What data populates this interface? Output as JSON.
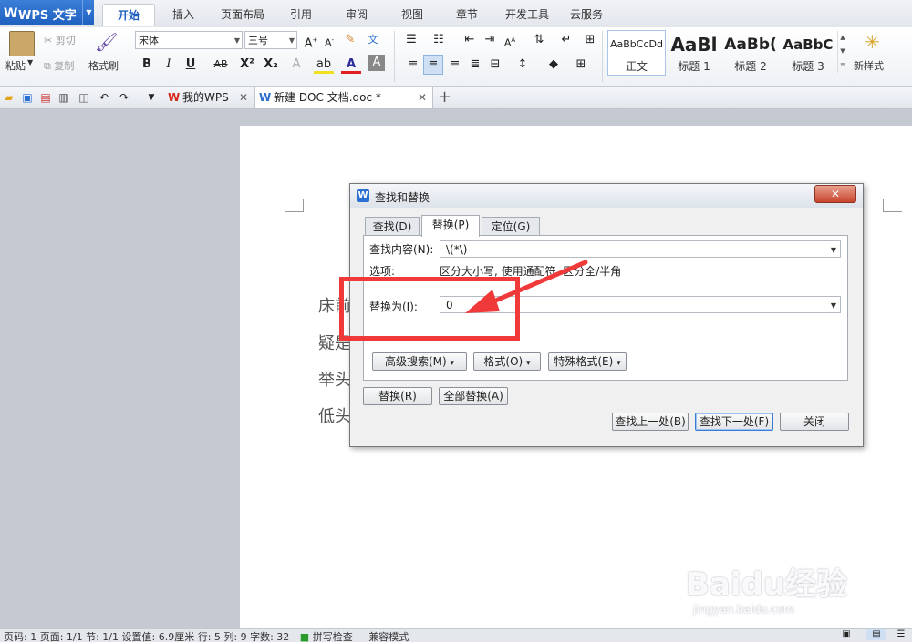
{
  "app": {
    "title": "WPS 文字",
    "logo": "W"
  },
  "ribbon_tabs": [
    "开始",
    "插入",
    "页面布局",
    "引用",
    "审阅",
    "视图",
    "章节",
    "开发工具",
    "云服务"
  ],
  "ribbon": {
    "paste": "粘贴",
    "cut": "剪切",
    "copy": "复制",
    "format_painter": "格式刷",
    "font_name": "宋体",
    "font_size": "三号",
    "bold": "B",
    "italic": "I",
    "underline": "U",
    "strike": "AB",
    "superscript": "X²",
    "subscript": "X₂",
    "styles": [
      {
        "preview": "AaBbCcDd",
        "label": "正文"
      },
      {
        "preview": "AaBl",
        "label": "标题 1"
      },
      {
        "preview": "AaBb(",
        "label": "标题 2"
      },
      {
        "preview": "AaBbC",
        "label": "标题 3"
      }
    ],
    "new_style": "新样式"
  },
  "doc_tabs": [
    {
      "label": "我的WPS",
      "icon": "wps-icon"
    },
    {
      "label": "新建 DOC 文档.doc *",
      "icon": "doc-icon"
    }
  ],
  "page_text": [
    "床前",
    "疑是",
    "举头",
    "低头"
  ],
  "status": {
    "text": "页码: 1  页面: 1/1  节: 1/1  设置值: 6.9厘米  行: 5  列: 9  字数: 32",
    "spell": "拼写检查",
    "mode": "兼容模式"
  },
  "dialog": {
    "title": "查找和替换",
    "tabs": [
      "查找(D)",
      "替换(P)",
      "定位(G)"
    ],
    "find_label": "查找内容(N):",
    "find_value": "\\(*\\)",
    "options_label": "选项:",
    "options_value": "区分大小写, 使用通配符, 区分全/半角",
    "replace_label": "替换为(I):",
    "replace_value": "0",
    "buttons": {
      "advanced": "高级搜索(M)",
      "format": "格式(O)",
      "special": "特殊格式(E)",
      "replace": "替换(R)",
      "replace_all": "全部替换(A)",
      "find_prev": "查找上一处(B)",
      "find_next": "查找下一处(F)",
      "close": "关闭"
    }
  },
  "watermark": {
    "brand": "Baidu经验",
    "url": "jingyan.baidu.com"
  },
  "colors": {
    "accent": "#1e5fbf",
    "annotation": "#f03a3a"
  }
}
